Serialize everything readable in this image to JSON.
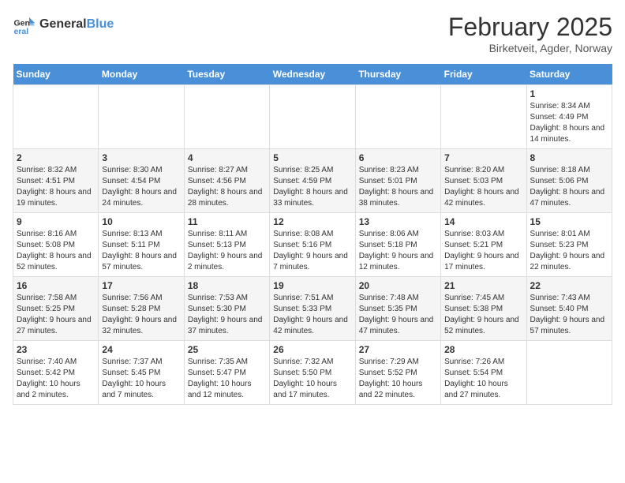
{
  "logo": {
    "text_general": "General",
    "text_blue": "Blue"
  },
  "title": "February 2025",
  "subtitle": "Birketveit, Agder, Norway",
  "days_of_week": [
    "Sunday",
    "Monday",
    "Tuesday",
    "Wednesday",
    "Thursday",
    "Friday",
    "Saturday"
  ],
  "weeks": [
    [
      {
        "day": "",
        "info": ""
      },
      {
        "day": "",
        "info": ""
      },
      {
        "day": "",
        "info": ""
      },
      {
        "day": "",
        "info": ""
      },
      {
        "day": "",
        "info": ""
      },
      {
        "day": "",
        "info": ""
      },
      {
        "day": "1",
        "info": "Sunrise: 8:34 AM\nSunset: 4:49 PM\nDaylight: 8 hours and 14 minutes."
      }
    ],
    [
      {
        "day": "2",
        "info": "Sunrise: 8:32 AM\nSunset: 4:51 PM\nDaylight: 8 hours and 19 minutes."
      },
      {
        "day": "3",
        "info": "Sunrise: 8:30 AM\nSunset: 4:54 PM\nDaylight: 8 hours and 24 minutes."
      },
      {
        "day": "4",
        "info": "Sunrise: 8:27 AM\nSunset: 4:56 PM\nDaylight: 8 hours and 28 minutes."
      },
      {
        "day": "5",
        "info": "Sunrise: 8:25 AM\nSunset: 4:59 PM\nDaylight: 8 hours and 33 minutes."
      },
      {
        "day": "6",
        "info": "Sunrise: 8:23 AM\nSunset: 5:01 PM\nDaylight: 8 hours and 38 minutes."
      },
      {
        "day": "7",
        "info": "Sunrise: 8:20 AM\nSunset: 5:03 PM\nDaylight: 8 hours and 42 minutes."
      },
      {
        "day": "8",
        "info": "Sunrise: 8:18 AM\nSunset: 5:06 PM\nDaylight: 8 hours and 47 minutes."
      }
    ],
    [
      {
        "day": "9",
        "info": "Sunrise: 8:16 AM\nSunset: 5:08 PM\nDaylight: 8 hours and 52 minutes."
      },
      {
        "day": "10",
        "info": "Sunrise: 8:13 AM\nSunset: 5:11 PM\nDaylight: 8 hours and 57 minutes."
      },
      {
        "day": "11",
        "info": "Sunrise: 8:11 AM\nSunset: 5:13 PM\nDaylight: 9 hours and 2 minutes."
      },
      {
        "day": "12",
        "info": "Sunrise: 8:08 AM\nSunset: 5:16 PM\nDaylight: 9 hours and 7 minutes."
      },
      {
        "day": "13",
        "info": "Sunrise: 8:06 AM\nSunset: 5:18 PM\nDaylight: 9 hours and 12 minutes."
      },
      {
        "day": "14",
        "info": "Sunrise: 8:03 AM\nSunset: 5:21 PM\nDaylight: 9 hours and 17 minutes."
      },
      {
        "day": "15",
        "info": "Sunrise: 8:01 AM\nSunset: 5:23 PM\nDaylight: 9 hours and 22 minutes."
      }
    ],
    [
      {
        "day": "16",
        "info": "Sunrise: 7:58 AM\nSunset: 5:25 PM\nDaylight: 9 hours and 27 minutes."
      },
      {
        "day": "17",
        "info": "Sunrise: 7:56 AM\nSunset: 5:28 PM\nDaylight: 9 hours and 32 minutes."
      },
      {
        "day": "18",
        "info": "Sunrise: 7:53 AM\nSunset: 5:30 PM\nDaylight: 9 hours and 37 minutes."
      },
      {
        "day": "19",
        "info": "Sunrise: 7:51 AM\nSunset: 5:33 PM\nDaylight: 9 hours and 42 minutes."
      },
      {
        "day": "20",
        "info": "Sunrise: 7:48 AM\nSunset: 5:35 PM\nDaylight: 9 hours and 47 minutes."
      },
      {
        "day": "21",
        "info": "Sunrise: 7:45 AM\nSunset: 5:38 PM\nDaylight: 9 hours and 52 minutes."
      },
      {
        "day": "22",
        "info": "Sunrise: 7:43 AM\nSunset: 5:40 PM\nDaylight: 9 hours and 57 minutes."
      }
    ],
    [
      {
        "day": "23",
        "info": "Sunrise: 7:40 AM\nSunset: 5:42 PM\nDaylight: 10 hours and 2 minutes."
      },
      {
        "day": "24",
        "info": "Sunrise: 7:37 AM\nSunset: 5:45 PM\nDaylight: 10 hours and 7 minutes."
      },
      {
        "day": "25",
        "info": "Sunrise: 7:35 AM\nSunset: 5:47 PM\nDaylight: 10 hours and 12 minutes."
      },
      {
        "day": "26",
        "info": "Sunrise: 7:32 AM\nSunset: 5:50 PM\nDaylight: 10 hours and 17 minutes."
      },
      {
        "day": "27",
        "info": "Sunrise: 7:29 AM\nSunset: 5:52 PM\nDaylight: 10 hours and 22 minutes."
      },
      {
        "day": "28",
        "info": "Sunrise: 7:26 AM\nSunset: 5:54 PM\nDaylight: 10 hours and 27 minutes."
      },
      {
        "day": "",
        "info": ""
      }
    ]
  ]
}
